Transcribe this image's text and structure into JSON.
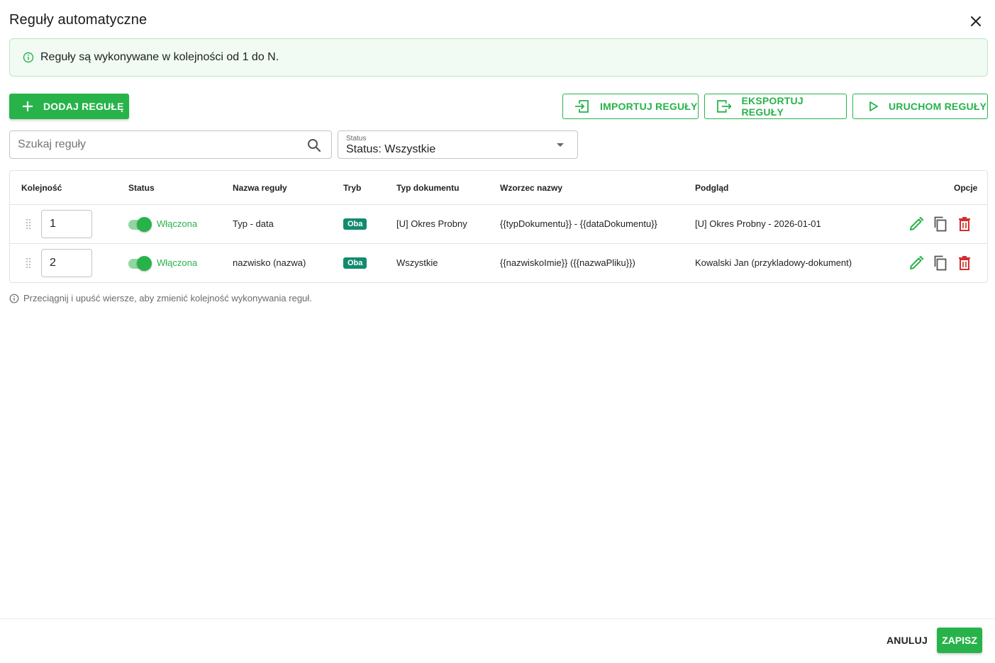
{
  "dialog": {
    "title": "Reguły automatyczne"
  },
  "info": {
    "text": "Reguły są wykonywane w kolejności od 1 do N."
  },
  "toolbar": {
    "add_label": "DODAJ REGUŁĘ",
    "import_label": "IMPORTUJ REGUŁY",
    "export_label": "EKSPORTUJ REGUŁY",
    "run_label": "URUCHOM REGUŁY"
  },
  "search": {
    "placeholder": "Szukaj reguły",
    "value": ""
  },
  "status_filter": {
    "label": "Status",
    "value": "Status: Wszystkie"
  },
  "table": {
    "headers": [
      "Kolejność",
      "Status",
      "Nazwa reguły",
      "Tryb",
      "Typ dokumentu",
      "Wzorzec nazwy",
      "Podgląd",
      "Opcje"
    ],
    "rows": [
      {
        "order": "1",
        "status": "Włączona",
        "enabled": true,
        "name": "Typ - data",
        "mode": "Oba",
        "doc_type": "[U] Okres Probny",
        "pattern": "{{typDokumentu}} - {{dataDokumentu}}",
        "preview": "[U] Okres Probny - 2026-01-01"
      },
      {
        "order": "2",
        "status": "Włączona",
        "enabled": true,
        "name": "nazwisko (nazwa)",
        "mode": "Oba",
        "doc_type": "Wszystkie",
        "pattern": "{{nazwiskoImie}} ({{nazwaPliku}})",
        "preview": "Kowalski Jan (przykladowy-dokument)"
      }
    ]
  },
  "hint": {
    "text": "Przeciągnij i upuść wiersze, aby zmienić kolejność wykonywania reguł."
  },
  "footer": {
    "cancel_label": "ANULUJ",
    "save_label": "ZAPISZ"
  },
  "colors": {
    "accent": "#27b34a",
    "badge": "#138a6e",
    "danger": "#d32f2f",
    "info_bg": "#f1fbf3"
  },
  "icons": [
    "close-icon",
    "info-icon",
    "plus-icon",
    "import-icon",
    "export-icon",
    "play-icon",
    "search-icon",
    "chevron-down-icon",
    "drag-handle-icon",
    "edit-icon",
    "copy-icon",
    "delete-icon"
  ]
}
